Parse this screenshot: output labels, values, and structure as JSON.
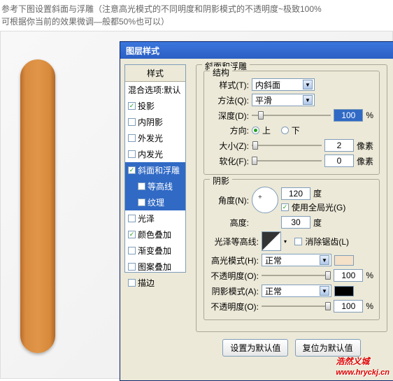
{
  "instruction_line1": "参考下图设置斜面与浮雕（注意高光模式的不同明度和阴影模式的不透明度~极致100%",
  "instruction_line2": "可根据你当前的效果微调—般都50%也可以）",
  "dialog": {
    "title": "图层样式"
  },
  "styles": {
    "header": "样式",
    "blend": "混合选项:默认",
    "items": [
      {
        "label": "投影",
        "checked": true
      },
      {
        "label": "内阴影",
        "checked": false
      },
      {
        "label": "外发光",
        "checked": false
      },
      {
        "label": "内发光",
        "checked": false
      },
      {
        "label": "斜面和浮雕",
        "checked": true,
        "selected": true
      },
      {
        "label": "等高线",
        "checked": false,
        "indent": true,
        "selected": true
      },
      {
        "label": "纹理",
        "checked": false,
        "indent": true,
        "selected": true
      },
      {
        "label": "光泽",
        "checked": false
      },
      {
        "label": "颜色叠加",
        "checked": true
      },
      {
        "label": "渐变叠加",
        "checked": false
      },
      {
        "label": "图案叠加",
        "checked": false
      },
      {
        "label": "描边",
        "checked": false
      }
    ]
  },
  "bevel": {
    "section": "斜面和浮雕",
    "structure": "结构",
    "style_lbl": "样式(T):",
    "style_val": "内斜面",
    "tech_lbl": "方法(Q):",
    "tech_val": "平滑",
    "depth_lbl": "深度(D):",
    "depth_val": "100",
    "pct": "%",
    "dir_lbl": "方向:",
    "up": "上",
    "down": "下",
    "size_lbl": "大小(Z):",
    "size_val": "2",
    "px": "像素",
    "soften_lbl": "软化(F):",
    "soften_val": "0",
    "shading": "阴影",
    "angle_lbl": "角度(N):",
    "angle_val": "120",
    "deg": "度",
    "global": "使用全局光(G)",
    "alt_lbl": "高度:",
    "alt_val": "30",
    "gloss_lbl": "光泽等高线:",
    "aa": "消除锯齿(L)",
    "hi_lbl": "高光模式(H):",
    "hi_val": "正常",
    "hi_op": "100",
    "sh_lbl": "阴影模式(A):",
    "sh_val": "正常",
    "sh_op": "100",
    "opacity_lbl": "不透明度(O):"
  },
  "buttons": {
    "default": "设置为默认值",
    "reset": "复位为默认值"
  },
  "watermark": {
    "name": "浩然义城",
    "url": "www.hryckj.cn"
  }
}
